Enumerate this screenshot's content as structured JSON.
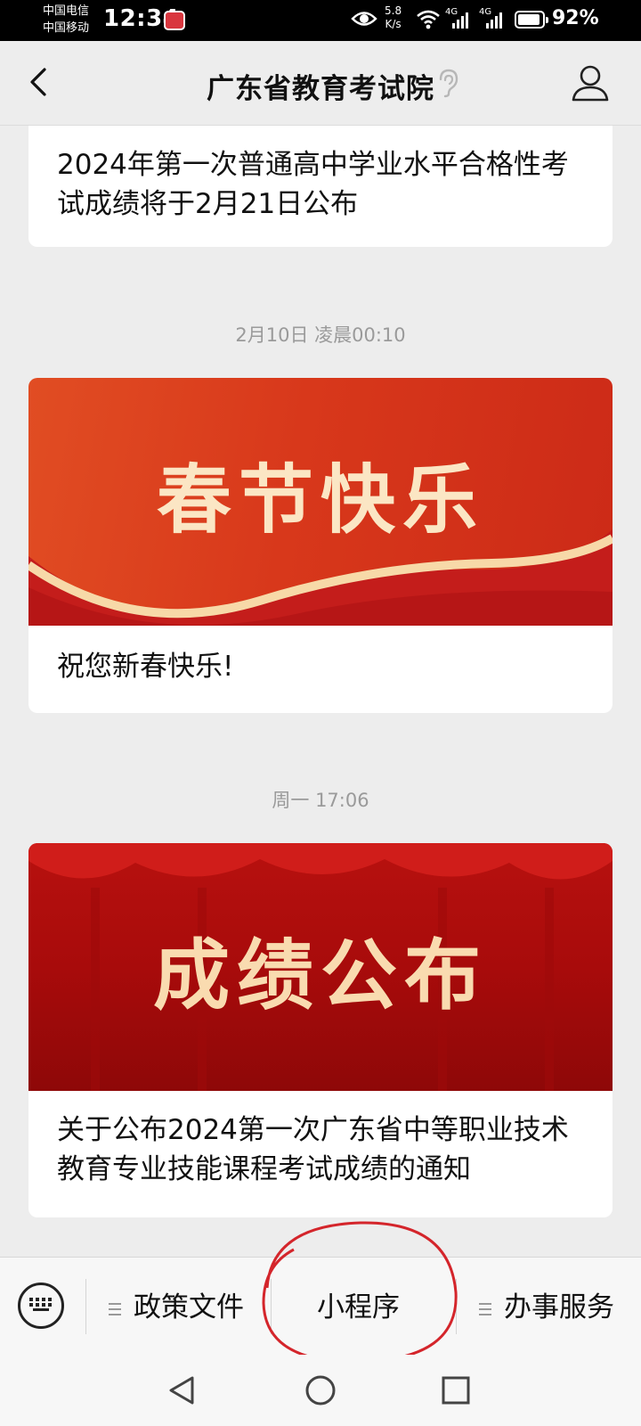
{
  "status_bar": {
    "carrier1": "中国电信",
    "carrier2": "中国移动",
    "time": "12:34",
    "speed_value": "5.8",
    "speed_unit": "K/s",
    "net1": "4G",
    "net2": "4G",
    "battery": "92%",
    "battery_level": 0.92
  },
  "header": {
    "title": "广东省教育考试院",
    "back_icon": "chevron-left-icon",
    "ear_icon": "ear-icon",
    "profile_icon": "user-icon"
  },
  "feed": {
    "article1": {
      "text": "2024年第一次普通高中学业水平合格性考试成绩将于2月21日公布"
    },
    "timestamp1": "2月10日 凌晨00:10",
    "article2": {
      "banner": "春节快乐",
      "text": "祝您新春快乐!"
    },
    "timestamp2": "周一 17:06",
    "article3": {
      "banner": "成绩公布",
      "text": "关于公布2024第一次广东省中等职业技术教育专业技能课程考试成绩的通知"
    }
  },
  "menu": {
    "keyboard_icon": "keyboard-icon",
    "item1": "政策文件",
    "item2": "小程序",
    "item3": "办事服务"
  },
  "colors": {
    "annotation_circle": "#d4252b",
    "banner_red": "#d8381b",
    "banner_dark_red": "#a80b0b",
    "banner_gold": "#f6d9a6"
  }
}
